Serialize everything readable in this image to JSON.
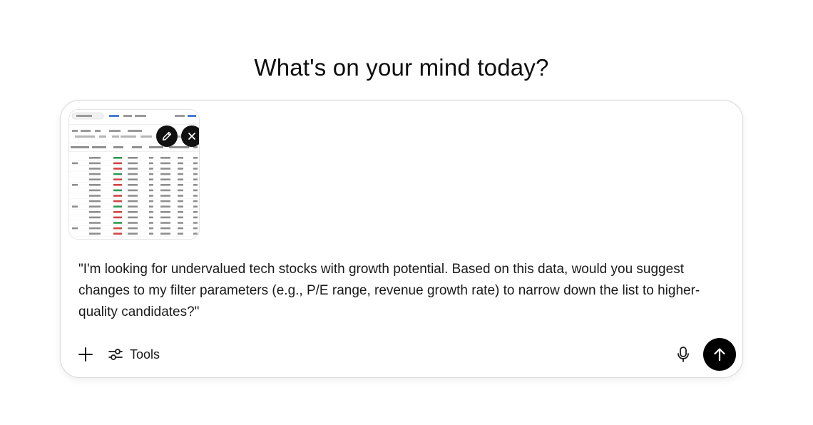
{
  "headline": "What's on your mind today?",
  "composer": {
    "attachment": {
      "kind": "screenshot-thumbnail",
      "edit_icon": "pencil-icon",
      "remove_icon": "close-icon"
    },
    "prompt_text": "\"I'm looking for undervalued tech stocks with growth potential. Based on this data, would you suggest changes to my filter parameters (e.g., P/E range, revenue growth rate) to narrow down the list to higher-quality candidates?\"",
    "toolbar": {
      "add_icon": "plus-icon",
      "tools_icon": "sliders-icon",
      "tools_label": "Tools",
      "mic_icon": "microphone-icon",
      "send_icon": "arrow-up-icon"
    }
  },
  "colors": {
    "text": "#0d0d0d",
    "border": "#dcdcdc",
    "send_button": "#000000"
  }
}
